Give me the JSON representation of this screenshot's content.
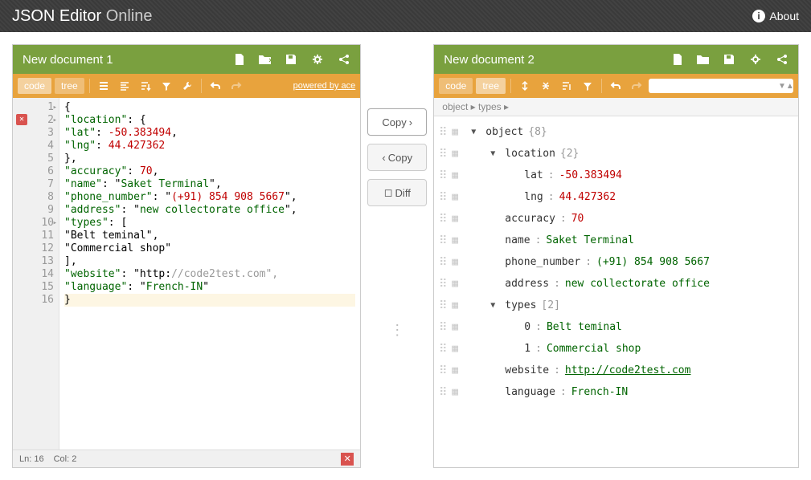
{
  "header": {
    "title_a": "JSON Editor",
    "title_b": "Online",
    "about": "About"
  },
  "left": {
    "title": "New document 1",
    "mode_code": "code",
    "mode_tree": "tree",
    "powered": "powered by ace",
    "status_ln": "Ln: 16",
    "status_col": "Col: 2",
    "lines": [
      {
        "n": "1",
        "fold": "▾",
        "txt": "{"
      },
      {
        "n": "2",
        "fold": "▾",
        "err": true,
        "txt": "\"location\": {"
      },
      {
        "n": "3",
        "txt": "\"lat\": -50.383494,"
      },
      {
        "n": "4",
        "txt": "\"lng\": 44.427362"
      },
      {
        "n": "5",
        "txt": "},"
      },
      {
        "n": "6",
        "txt": "\"accuracy\": 70,"
      },
      {
        "n": "7",
        "txt": "\"name\": \"Saket Terminal\","
      },
      {
        "n": "8",
        "txt": "\"phone_number\": \"(+91) 854 908 5667\","
      },
      {
        "n": "9",
        "txt": "\"address\": \"new collectorate office\","
      },
      {
        "n": "10",
        "fold": "▾",
        "txt": "\"types\": ["
      },
      {
        "n": "11",
        "txt": "\"Belt teminal\","
      },
      {
        "n": "12",
        "txt": "\"Commercial shop\""
      },
      {
        "n": "13",
        "txt": "],"
      },
      {
        "n": "14",
        "txt": "\"website\": \"http://code2test.com\","
      },
      {
        "n": "15",
        "txt": "\"language\": \"French-IN\""
      },
      {
        "n": "16",
        "hl": true,
        "txt": "}"
      }
    ]
  },
  "middle": {
    "copy_r": "Copy",
    "copy_l": "Copy",
    "diff": "Diff"
  },
  "right": {
    "title": "New document 2",
    "mode_code": "code",
    "mode_tree": "tree",
    "breadcrumb": "object ▸ types ▸",
    "search_placeholder": "",
    "tree": [
      {
        "indent": 0,
        "expand": "▼",
        "key": "object",
        "count": "{8}"
      },
      {
        "indent": 1,
        "expand": "▼",
        "key": "location",
        "count": "{2}"
      },
      {
        "indent": 2,
        "key": "lat",
        "sep": ":",
        "val": "-50.383494",
        "type": "num"
      },
      {
        "indent": 2,
        "key": "lng",
        "sep": ":",
        "val": "44.427362",
        "type": "num"
      },
      {
        "indent": 1,
        "key": "accuracy",
        "sep": ":",
        "val": "70",
        "type": "num"
      },
      {
        "indent": 1,
        "key": "name",
        "sep": ":",
        "val": "Saket Terminal",
        "type": "str"
      },
      {
        "indent": 1,
        "key": "phone_number",
        "sep": ":",
        "val": "(+91) 854 908 5667",
        "type": "str"
      },
      {
        "indent": 1,
        "key": "address",
        "sep": ":",
        "val": "new collectorate office",
        "type": "str"
      },
      {
        "indent": 1,
        "expand": "▼",
        "key": "types",
        "count": "[2]"
      },
      {
        "indent": 2,
        "key": "0",
        "sep": ":",
        "val": "Belt teminal",
        "type": "str"
      },
      {
        "indent": 2,
        "key": "1",
        "sep": ":",
        "val": "Commercial shop",
        "type": "str"
      },
      {
        "indent": 1,
        "key": "website",
        "sep": ":",
        "val": "http://code2test.com",
        "type": "link"
      },
      {
        "indent": 1,
        "key": "language",
        "sep": ":",
        "val": "French-IN",
        "type": "str"
      }
    ]
  }
}
